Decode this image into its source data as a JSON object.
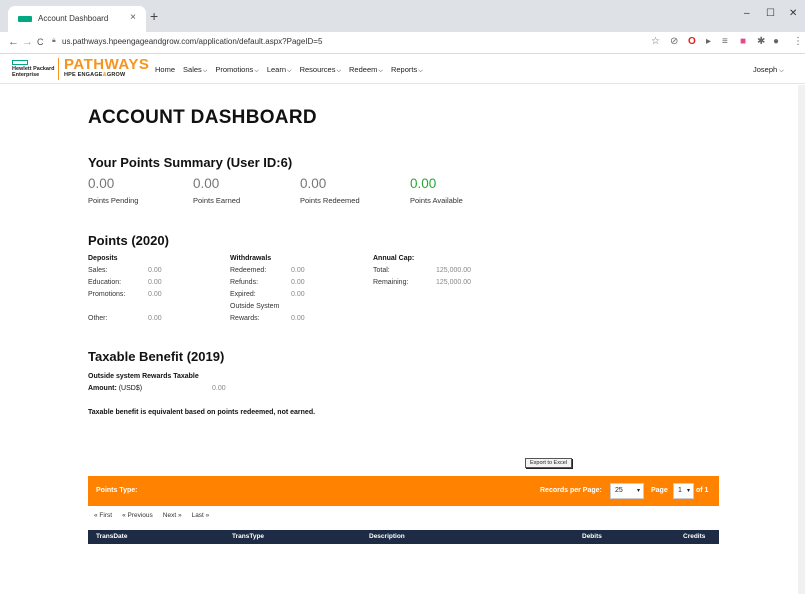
{
  "browser": {
    "tab_title": "Account Dashboard",
    "tab_close": "×",
    "new_tab": "+",
    "url": "us.pathways.hpeengageandgrow.com/application/default.aspx?PageID=5",
    "win_min": "–",
    "win_max": "☐",
    "win_close": "✕",
    "back": "←",
    "forward": "→",
    "reload": "C"
  },
  "header": {
    "hpe_line1": "Hewlett Packard",
    "hpe_line2": "Enterprise",
    "brand": "PATHWAYS",
    "brand_sub_a": "HPE ENGAGE",
    "brand_sub_b": "&",
    "brand_sub_c": "GROW",
    "menu": [
      "Home",
      "Sales",
      "Promotions",
      "Learn",
      "Resources",
      "Redeem",
      "Reports"
    ],
    "user": "Joseph"
  },
  "page_title": "ACCOUNT DASHBOARD",
  "summary": {
    "heading": "Your Points Summary (User ID:6)",
    "items": [
      {
        "value": "0.00",
        "label": "Points Pending"
      },
      {
        "value": "0.00",
        "label": "Points Earned"
      },
      {
        "value": "0.00",
        "label": "Points Redeemed"
      },
      {
        "value": "0.00",
        "label": "Points Available"
      }
    ]
  },
  "points": {
    "heading": "Points (2020)",
    "deposits": {
      "title": "Deposits",
      "rows": [
        {
          "label": "Sales:",
          "value": "0.00"
        },
        {
          "label": "Education:",
          "value": "0.00"
        },
        {
          "label": "Promotions:",
          "value": "0.00"
        },
        {
          "label": "Other:",
          "value": "0.00"
        }
      ]
    },
    "withdrawals": {
      "title": "Withdrawals",
      "rows": [
        {
          "label": "Redeemed:",
          "value": "0.00"
        },
        {
          "label": "Refunds:",
          "value": "0.00"
        },
        {
          "label": "Expired:",
          "value": "0.00"
        },
        {
          "label": "Outside System",
          "value": ""
        },
        {
          "label": "Rewards:",
          "value": "0.00"
        }
      ]
    },
    "annual_cap": {
      "title": "Annual Cap:",
      "rows": [
        {
          "label": "Total:",
          "value": "125,000.00"
        },
        {
          "label": "Remaining:",
          "value": "125,000.00"
        }
      ]
    }
  },
  "taxable": {
    "heading": "Taxable Benefit (2019)",
    "line1": "Outside system Rewards Taxable",
    "line2_bold": "Amount:",
    "line2_rest": " (USD$)",
    "value": "0.00",
    "note": "Taxable benefit is equivalent based on points redeemed, not earned."
  },
  "transactions": {
    "export_label": "Export to Excel",
    "points_type_label": "Points Type:",
    "records_per_page_label": "Records per Page:",
    "records_per_page_value": "25",
    "page_label": "Page",
    "page_value": "1",
    "page_of": "of 1",
    "pager": [
      "« First",
      "« Previous",
      "Next »",
      "Last »"
    ],
    "columns": [
      "TransDate",
      "TransType",
      "Description",
      "Debits",
      "Credits"
    ]
  },
  "colors": {
    "accent_orange": "#ff8300",
    "available_green": "#2aa63a",
    "table_header": "#1d2c44",
    "hpe_green": "#01a982"
  }
}
